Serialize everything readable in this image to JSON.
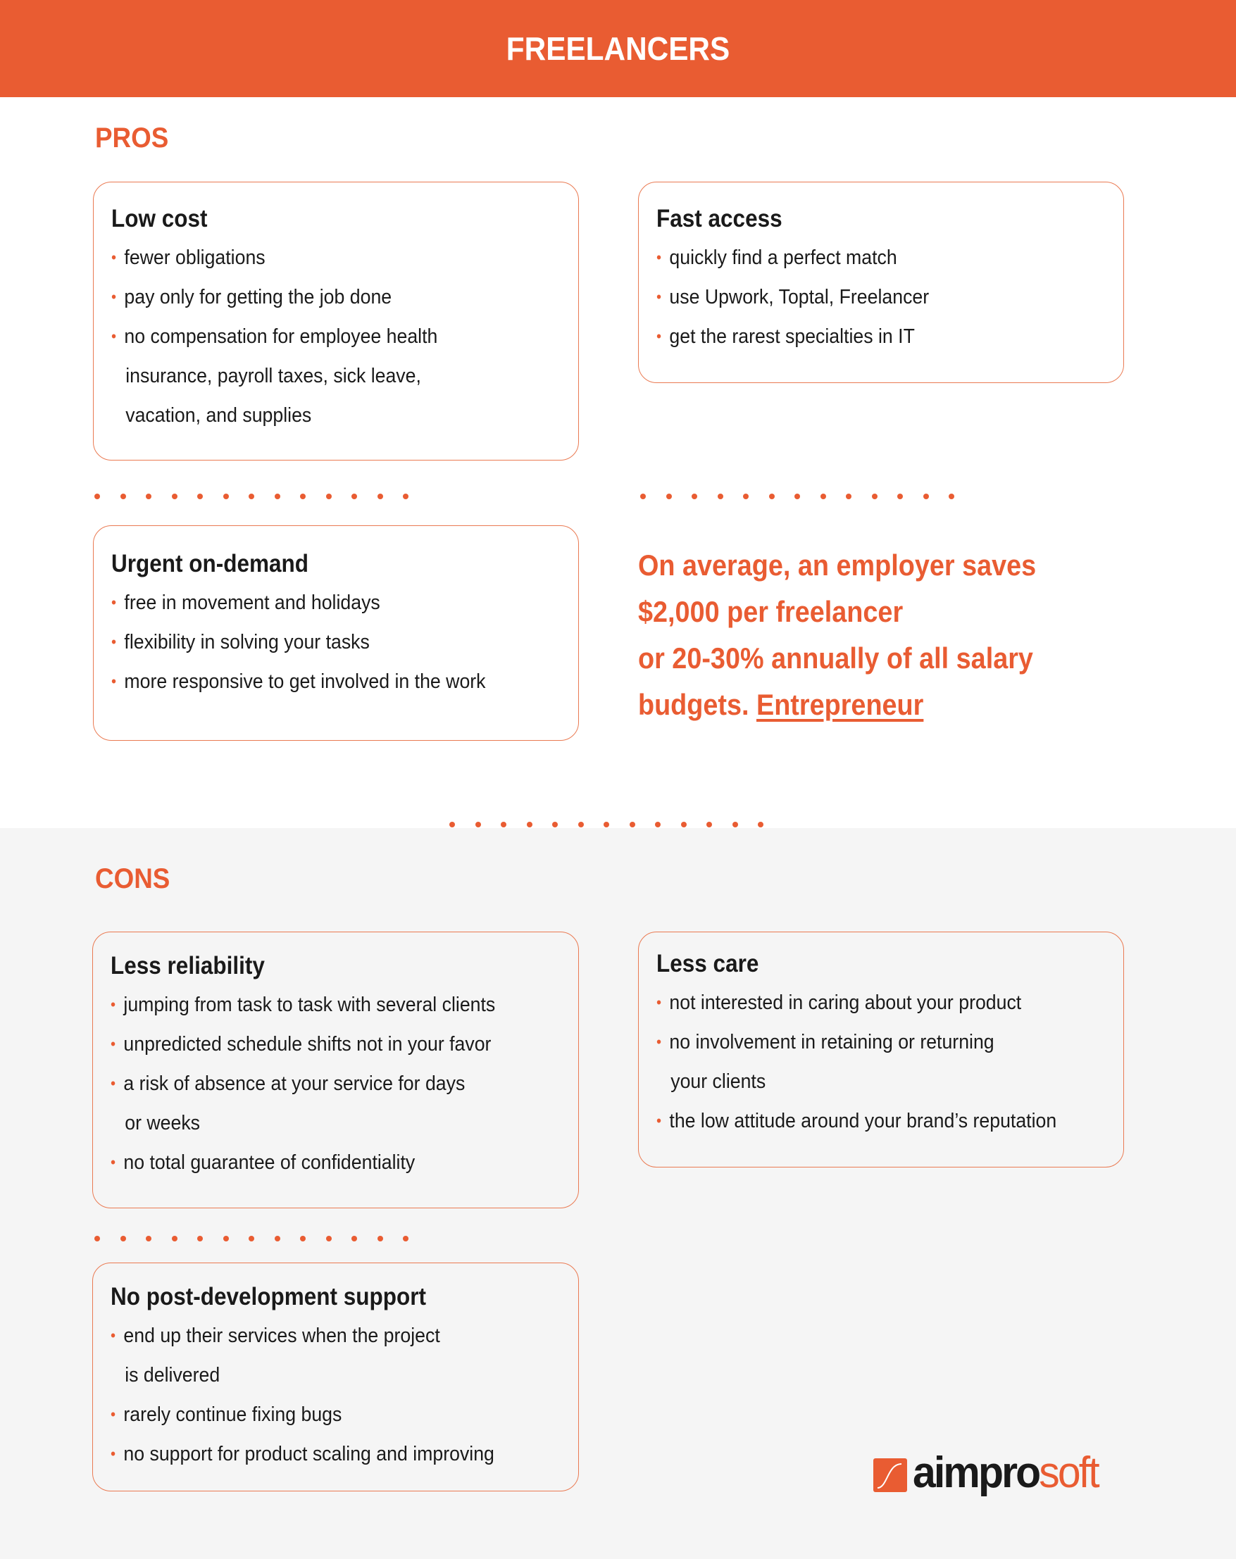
{
  "header": {
    "title": "FREELANCERS"
  },
  "colors": {
    "accent": "#e95c32",
    "text": "#1a1a1a",
    "cons_bg": "#f5f5f5"
  },
  "pros": {
    "label": "PROS",
    "cards": [
      {
        "title": "Low cost",
        "items": [
          {
            "lines": [
              "fewer obligations"
            ]
          },
          {
            "lines": [
              "pay only for getting the job done"
            ]
          },
          {
            "lines": [
              "no compensation for employee health",
              "insurance, payroll taxes, sick leave,",
              "vacation, and supplies"
            ]
          }
        ]
      },
      {
        "title": "Fast access",
        "items": [
          {
            "lines": [
              "quickly find a perfect match"
            ]
          },
          {
            "lines": [
              "use Upwork, Toptal, Freelancer"
            ]
          },
          {
            "lines": [
              "get the rarest specialties in IT"
            ]
          }
        ]
      },
      {
        "title": "Urgent on-demand",
        "items": [
          {
            "lines": [
              "free in movement and holidays"
            ]
          },
          {
            "lines": [
              "flexibility in solving your tasks"
            ]
          },
          {
            "lines": [
              "more responsive to get involved in the work"
            ]
          }
        ]
      }
    ],
    "quote": {
      "lines": [
        "On average, an employer saves",
        "$2,000 per freelancer",
        "or 20-30% annually of all salary"
      ],
      "last_line_prefix": "budgets. ",
      "source_link": "Entrepreneur"
    }
  },
  "cons": {
    "label": "CONS",
    "cards": [
      {
        "title": "Less reliability",
        "items": [
          {
            "lines": [
              "jumping from task to task with several clients"
            ]
          },
          {
            "lines": [
              "unpredicted schedule shifts not in your favor"
            ]
          },
          {
            "lines": [
              "a risk of absence at your service for days",
              "or weeks"
            ]
          },
          {
            "lines": [
              "no total guarantee of confidentiality"
            ]
          }
        ]
      },
      {
        "title": "Less care",
        "items": [
          {
            "lines": [
              "not interested in caring about your product"
            ]
          },
          {
            "lines": [
              "no involvement in retaining or returning",
              "your clients"
            ]
          },
          {
            "lines": [
              "the low attitude around your brand’s reputation"
            ]
          }
        ]
      },
      {
        "title": "No post-development support",
        "items": [
          {
            "lines": [
              "end up their services when the project",
              "is delivered"
            ]
          },
          {
            "lines": [
              "rarely continue fixing bugs"
            ]
          },
          {
            "lines": [
              "no support for product scaling and improving"
            ]
          }
        ]
      }
    ]
  },
  "logo": {
    "dark_part": "aimpro",
    "accent_part": "soft",
    "icon": "aimprosoft-s-curve-icon"
  }
}
